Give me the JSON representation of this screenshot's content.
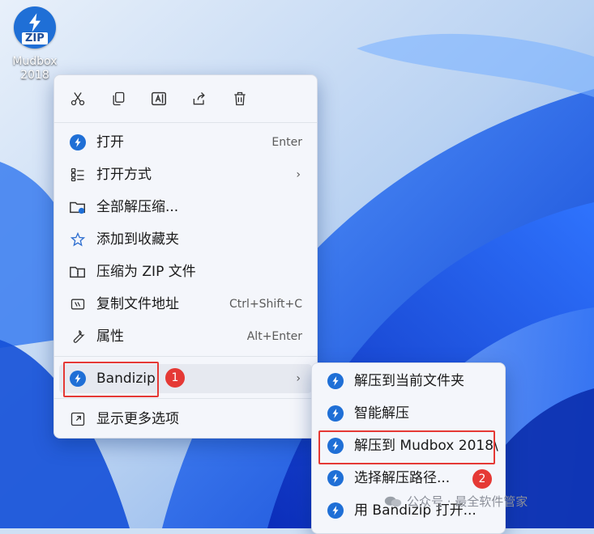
{
  "desktop": {
    "icon_label_line1": "Mudbox",
    "icon_label_line2": "2018",
    "icon_badge": "ZIP"
  },
  "context_menu": {
    "toolbar": [
      "scissors-icon",
      "copy-icon",
      "rename-icon",
      "share-icon",
      "trash-icon"
    ],
    "items": [
      {
        "label": "打开",
        "shortcut": "Enter"
      },
      {
        "label": "打开方式"
      },
      {
        "label": "全部解压缩..."
      },
      {
        "label": "添加到收藏夹"
      },
      {
        "label": "压缩为 ZIP 文件"
      },
      {
        "label": "复制文件地址",
        "shortcut": "Ctrl+Shift+C"
      },
      {
        "label": "属性",
        "shortcut": "Alt+Enter"
      },
      {
        "label": "Bandizip"
      },
      {
        "label": "显示更多选项"
      }
    ]
  },
  "submenu": {
    "items": [
      {
        "label": "解压到当前文件夹"
      },
      {
        "label": "智能解压"
      },
      {
        "label": "解压到 Mudbox 2018\\"
      },
      {
        "label": "选择解压路径..."
      },
      {
        "label": "用 Bandizip 打开..."
      }
    ]
  },
  "annotations": {
    "badge1": "1",
    "badge2": "2",
    "accent": "#e53935"
  },
  "watermark": {
    "text": "公众号 · 最全软件管家"
  }
}
